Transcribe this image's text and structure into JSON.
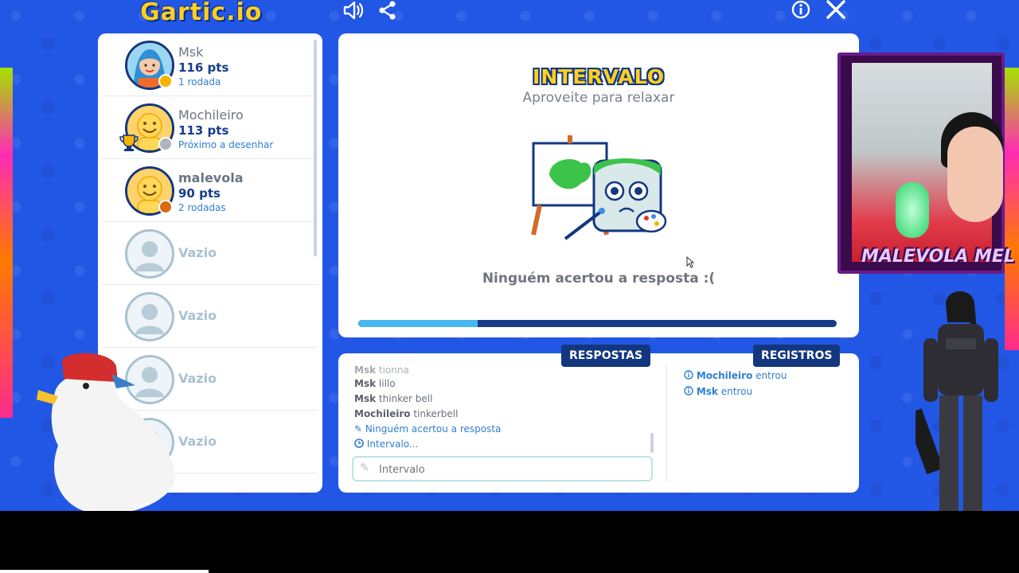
{
  "app": {
    "logo": "Gartic.io"
  },
  "topbar": {
    "icons": [
      "speaker-icon",
      "share-icon",
      "info-icon",
      "close-icon"
    ]
  },
  "players": [
    {
      "name": "Msk",
      "points": "116 pts",
      "info": "1 rodada",
      "badge_color": "#f6b500",
      "avatar": "girl-blue-hair"
    },
    {
      "name": "Mochileiro",
      "points": "113 pts",
      "info": "Próximo a desenhar",
      "badge_color": "#b0b5bb",
      "avatar": "smiley",
      "trophy": true
    },
    {
      "name": "malevola",
      "points": "90 pts",
      "info": "2 rodadas",
      "badge_color": "#d96a12",
      "avatar": "smiley"
    },
    {
      "name": "Vazio"
    },
    {
      "name": "Vazio"
    },
    {
      "name": "Vazio"
    },
    {
      "name": "Vazio"
    }
  ],
  "main": {
    "title": "INTERVALO",
    "subtitle": "Aproveite para relaxar",
    "message": "Ninguém acertou a resposta :(",
    "progress": 0.25
  },
  "chat": {
    "answers_tab": "RESPOSTAS",
    "logs_tab": "REGISTROS",
    "messages": [
      {
        "user": "Msk",
        "text": "tionna"
      },
      {
        "user": "Msk",
        "text": "lillo"
      },
      {
        "user": "Msk",
        "text": "thinker bell"
      },
      {
        "user": "Mochileiro",
        "text": "tinkerbell"
      }
    ],
    "system_messages": [
      {
        "icon": "pencil-icon",
        "text": "Ninguém acertou a resposta"
      },
      {
        "icon": "clock-icon",
        "text": "Intervalo..."
      }
    ],
    "input_placeholder": "Intervalo",
    "logs": [
      {
        "user": "Mochileiro",
        "text": "entrou"
      },
      {
        "user": "Msk",
        "text": "entrou"
      }
    ]
  },
  "stream": {
    "cam_name": "MALEVOLA MEL"
  },
  "colors": {
    "background": "#2257e6",
    "navy": "#13377f",
    "accent_blue": "#2f7fd1",
    "progress_fill": "#49b7f0",
    "yellow": "#ffcf22"
  }
}
